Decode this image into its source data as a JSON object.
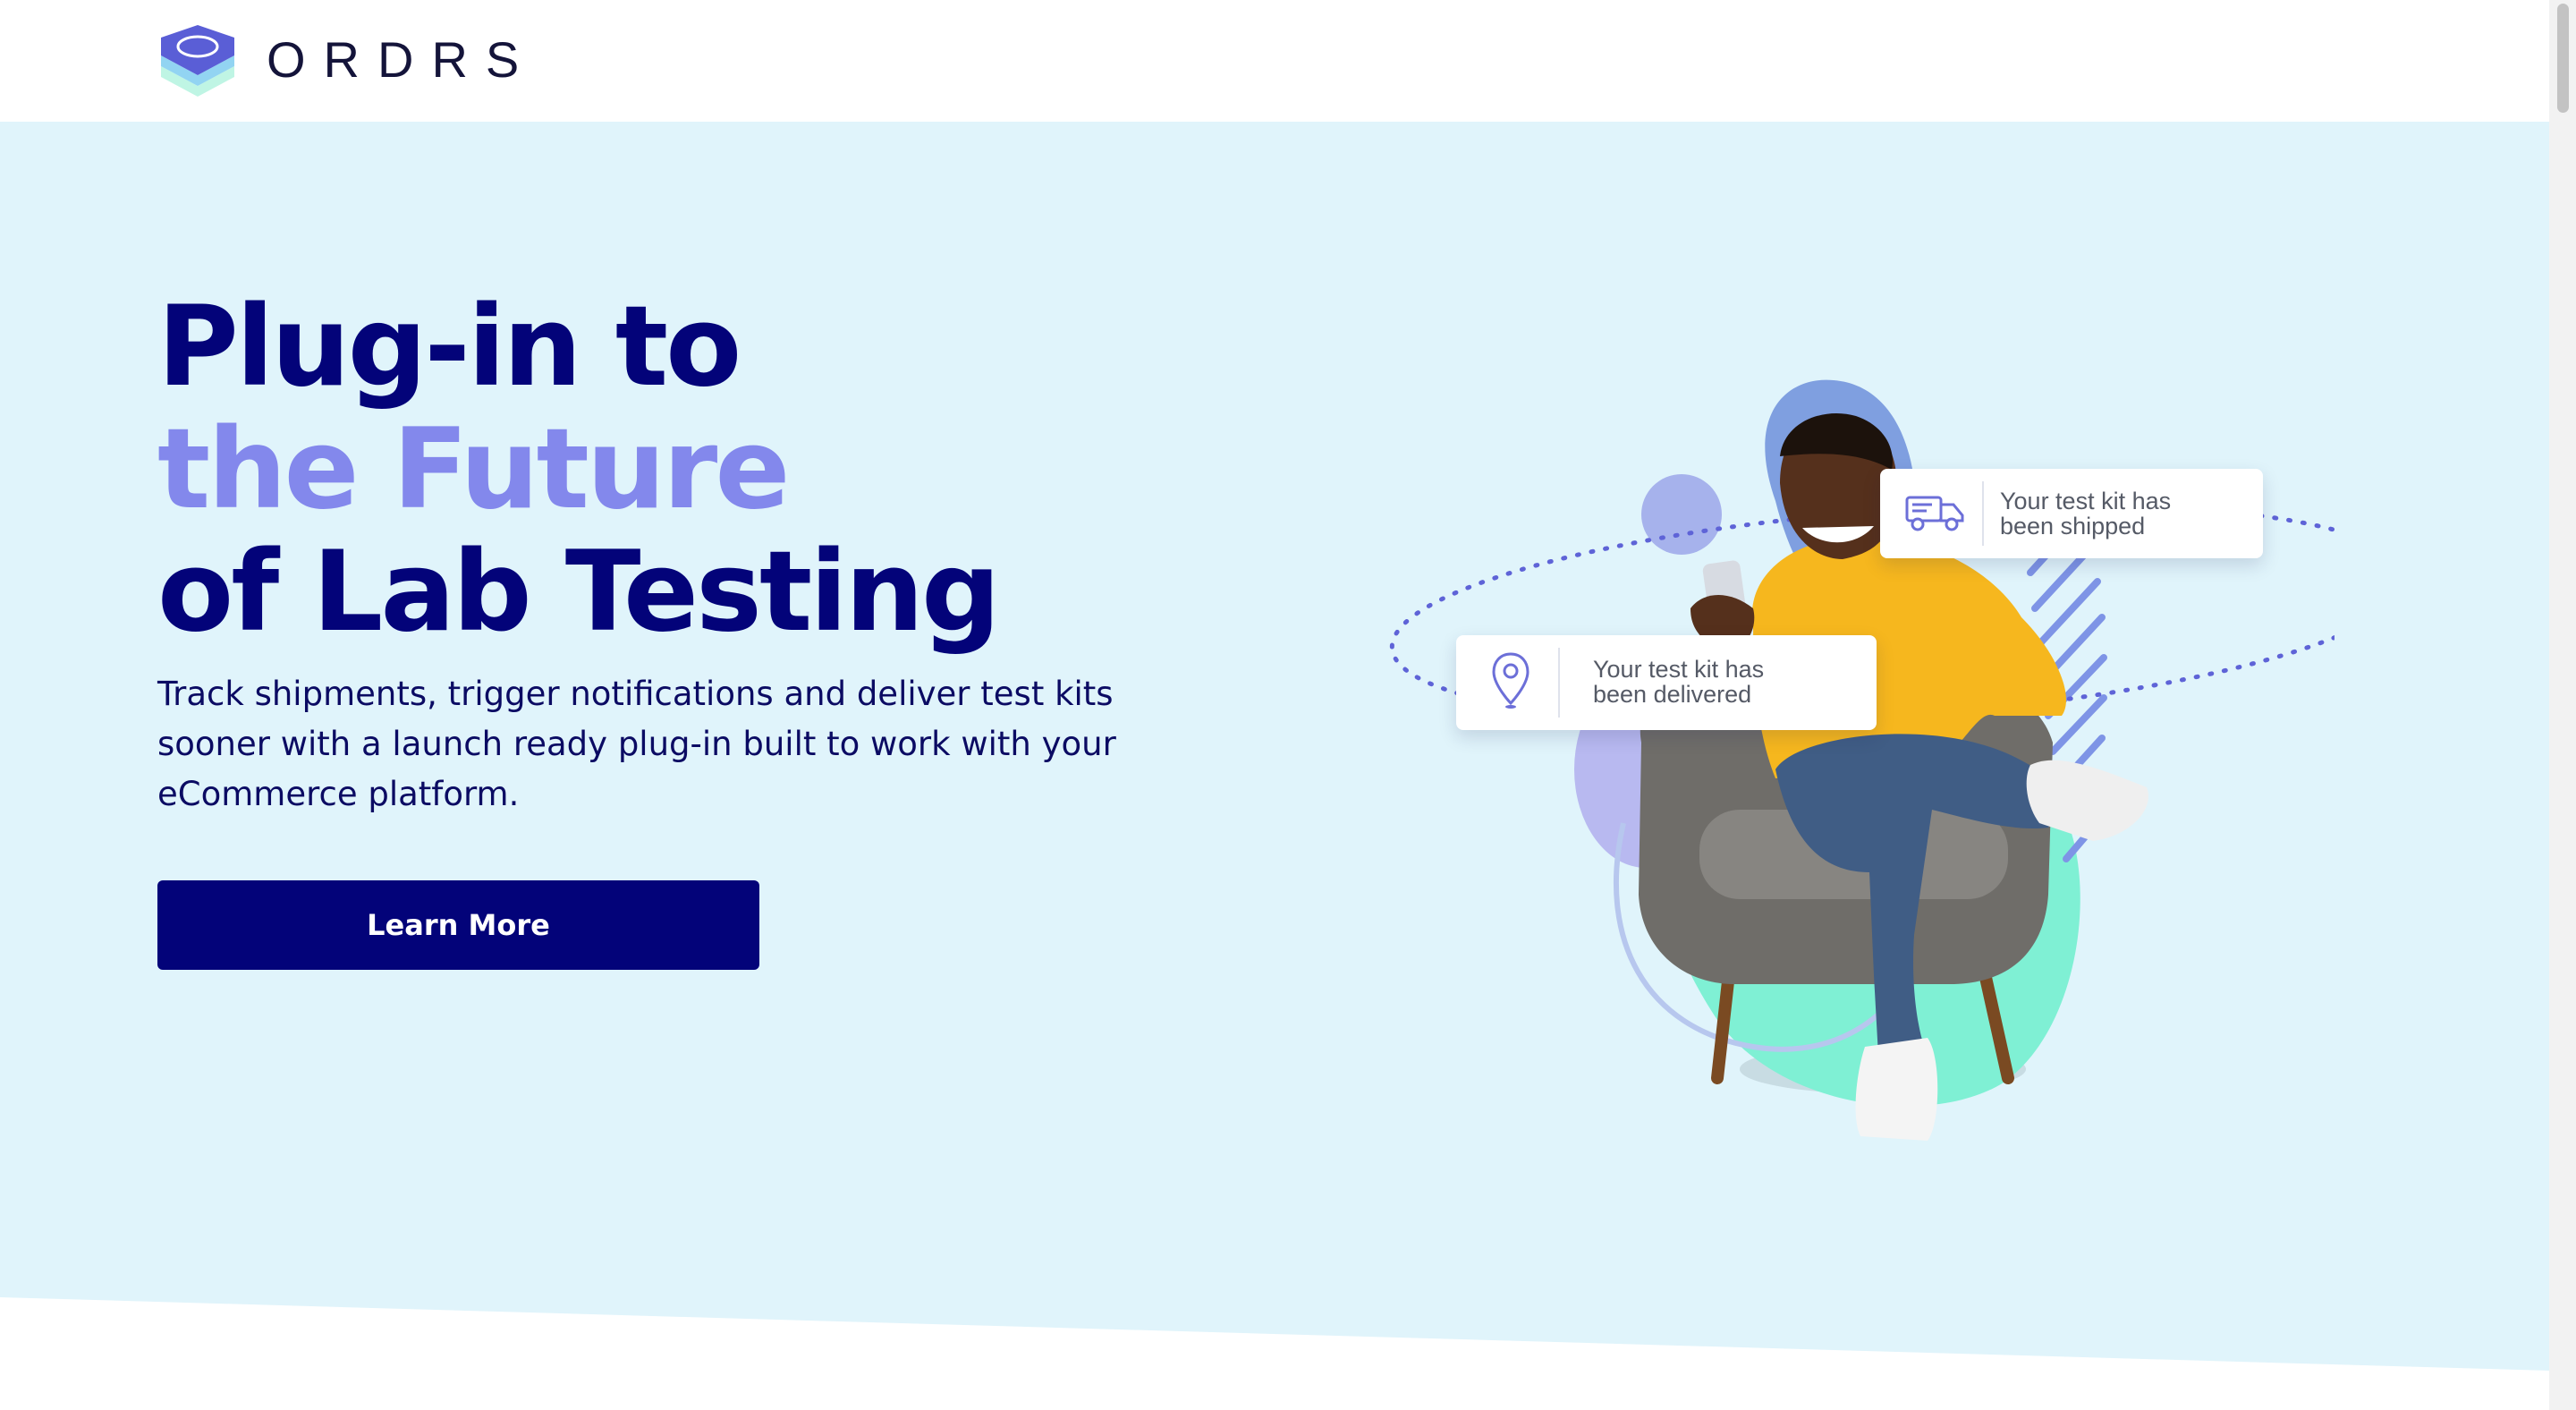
{
  "header": {
    "brand": "ORDRS",
    "logo_icon": "stacked-layers-logo"
  },
  "hero": {
    "headline_line1": "Plug-in to",
    "headline_line2": "the Future",
    "headline_line3": "of Lab Testing",
    "subtitle": "Track shipments, trigger notifications and deliver test kits sooner with a launch ready plug-in built to work with your eCommerce platform.",
    "cta_label": "Learn More"
  },
  "notifications": {
    "shipped": {
      "line1": "Your test kit has",
      "line2": "been shipped",
      "icon": "delivery-truck-icon"
    },
    "delivered": {
      "line1": "Your test kit has",
      "line2": "been delivered",
      "icon": "location-pin-icon"
    }
  },
  "colors": {
    "navy": "#030379",
    "accent_purple": "#8388ec",
    "hero_background": "#e0f4fb",
    "mint": "#7ff0d4",
    "hoodie_yellow": "#f6b71e"
  }
}
